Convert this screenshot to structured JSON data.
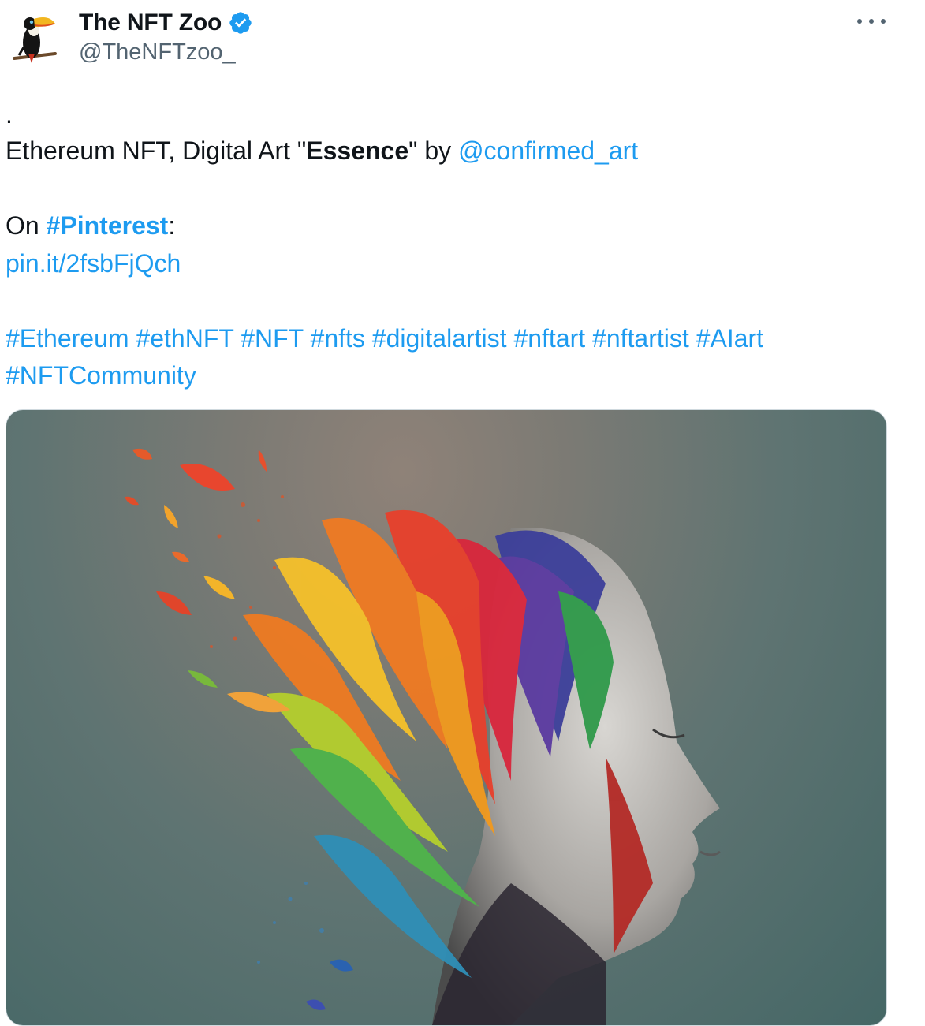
{
  "tweet": {
    "author": {
      "name": "The NFT Zoo",
      "handle": "@TheNFTzoo_",
      "verified_icon": "verified-badge-icon",
      "avatar_icon": "toucan-avatar-icon"
    },
    "more_icon": "more-options-icon",
    "text": {
      "dot": ".",
      "line1_prefix": "Ethereum NFT, Digital Art \"",
      "line1_title": "Essence",
      "line1_suffix": "\" by ",
      "line1_mention": "@confirmed_art",
      "line2_prefix": "On ",
      "line2_hashtag": "#Pinterest",
      "line2_suffix": ":",
      "link": "pin.it/2fsbFjQch",
      "hashtags_line1": [
        "#Ethereum",
        "#ethNFT",
        "#NFT",
        "#nfts",
        "#digitalartist",
        "#nftart",
        "#nftartist",
        "#AIart"
      ],
      "hashtags_line2": [
        "#NFTCommunity"
      ]
    },
    "media_icon": "rainbow-leaves-head-artwork"
  },
  "colors": {
    "link": "#1d9bf0",
    "text": "#0f1419",
    "secondary": "#536471",
    "verified": "#1d9bf0"
  }
}
